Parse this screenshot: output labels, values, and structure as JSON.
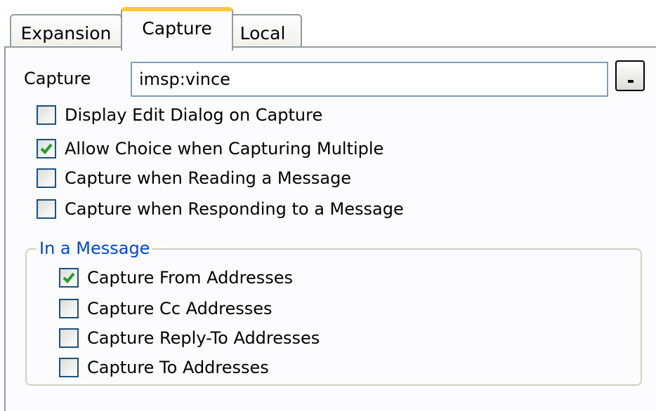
{
  "tabs": [
    {
      "label": "Expansion",
      "active": false
    },
    {
      "label": "Capture",
      "active": true
    },
    {
      "label": "Local",
      "active": false
    }
  ],
  "capture_field": {
    "label": "Capture",
    "value": "imsp:vince"
  },
  "options": [
    {
      "label": "Display Edit Dialog on Capture",
      "checked": false
    },
    {
      "label": "Allow Choice when Capturing Multiple",
      "checked": true
    },
    {
      "label": "Capture when Reading a Message",
      "checked": false
    },
    {
      "label": "Capture when Responding to a Message",
      "checked": false
    }
  ],
  "message_group": {
    "title": "In a Message",
    "options": [
      {
        "label": "Capture From Addresses",
        "checked": true
      },
      {
        "label": "Capture Cc Addresses",
        "checked": false
      },
      {
        "label": "Capture Reply-To Addresses",
        "checked": false
      },
      {
        "label": "Capture To Addresses",
        "checked": false
      }
    ]
  },
  "colors": {
    "tab_highlight": "#ffc73c",
    "checkbox_border": "#1c5180",
    "checkmark": "#21a121",
    "group_title": "#0046d5"
  },
  "icons": {
    "dropdown_button": "dropdown-icon",
    "checkmark": "checkmark-icon"
  }
}
